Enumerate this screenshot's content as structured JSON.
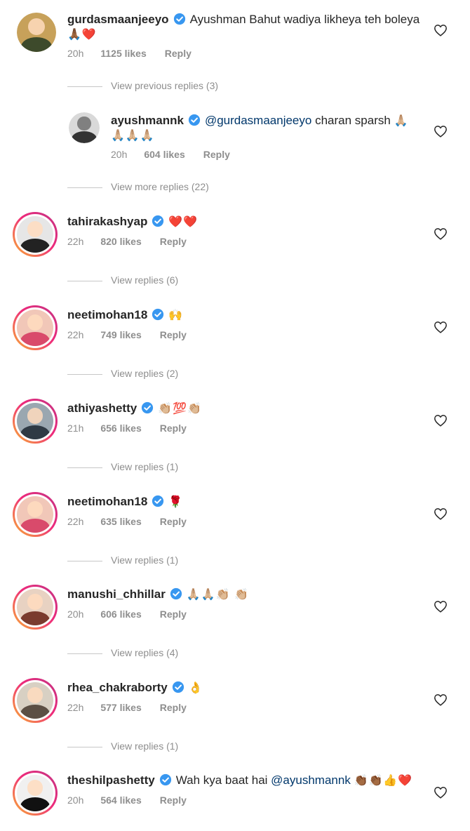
{
  "comments": [
    {
      "username": "gurdasmaanjeeyo",
      "text": "Ayushman Bahut wadiya likheya teh boleya",
      "emoji": "🙏🏾❤️",
      "time": "20h",
      "likes": "1125 likes",
      "reply": "Reply",
      "avatar_colors": [
        "#c7a15a",
        "#3d4a2b"
      ]
    },
    {
      "username": "ayushmannk",
      "mention": "@gurdasmaanjeeyo",
      "text": "charan sparsh",
      "emoji": "🙏🏼",
      "emoji2": "🙏🏼🙏🏼🙏🏼",
      "time": "20h",
      "likes": "604 likes",
      "reply": "Reply",
      "avatar_colors": [
        "#d9d9d9",
        "#333333"
      ]
    },
    {
      "username": "tahirakashyap",
      "emoji": "❤️❤️",
      "time": "22h",
      "likes": "820 likes",
      "reply": "Reply",
      "avatar_colors": [
        "#e6e6e6",
        "#222222"
      ]
    },
    {
      "username": "neetimohan18",
      "emoji": "🙌",
      "time": "22h",
      "likes": "749 likes",
      "reply": "Reply",
      "avatar_colors": [
        "#f1c7b8",
        "#d94a6b"
      ]
    },
    {
      "username": "athiyashetty",
      "emoji": "👏🏼💯👏🏼",
      "time": "21h",
      "likes": "656 likes",
      "reply": "Reply",
      "avatar_colors": [
        "#9aa7b0",
        "#2f3a44"
      ]
    },
    {
      "username": "neetimohan18",
      "emoji": "🌹",
      "time": "22h",
      "likes": "635 likes",
      "reply": "Reply",
      "avatar_colors": [
        "#f1c7b8",
        "#d94a6b"
      ]
    },
    {
      "username": "manushi_chhillar",
      "emoji": "🙏🏼🙏🏼👏🏼 👏🏼",
      "time": "20h",
      "likes": "606 likes",
      "reply": "Reply",
      "avatar_colors": [
        "#e8d2c2",
        "#7a3b2e"
      ]
    },
    {
      "username": "rhea_chakraborty",
      "emoji": "👌",
      "time": "22h",
      "likes": "577 likes",
      "reply": "Reply",
      "avatar_colors": [
        "#d8d0c3",
        "#5c4f44"
      ]
    },
    {
      "username": "theshilpashetty",
      "text": "Wah kya baat hai",
      "mention": "@ayushmannk",
      "emoji": "👏🏾👏🏾👍❤️",
      "time": "20h",
      "likes": "564 likes",
      "reply": "Reply",
      "avatar_colors": [
        "#f0f0f0",
        "#111111"
      ]
    }
  ],
  "reply_links": [
    "View previous replies (3)",
    "View more replies (22)",
    "View replies (6)",
    "View replies (2)",
    "View replies (1)",
    "View replies (1)",
    "View replies (4)",
    "View replies (1)"
  ],
  "colors": {
    "username": "#262626",
    "meta": "#8e8e8e",
    "mention": "#00376b",
    "verified": "#3897f0",
    "story_ring": [
      "#f9b233",
      "#ee2a7b",
      "#c13584"
    ]
  }
}
